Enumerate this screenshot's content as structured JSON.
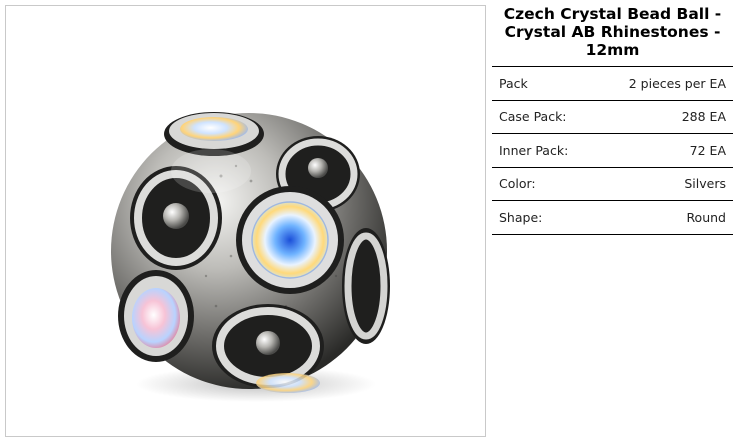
{
  "product": {
    "title": "Czech Crystal Bead Ball - Crystal AB Rhinestones - 12mm",
    "image_alt": "Czech crystal bead ball with crystal AB rhinestones"
  },
  "specs": [
    {
      "label": "Pack",
      "value": "2 pieces per EA"
    },
    {
      "label": "Case Pack:",
      "value": "288 EA"
    },
    {
      "label": "Inner Pack:",
      "value": "72 EA"
    },
    {
      "label": "Color:",
      "value": "Silvers"
    },
    {
      "label": "Shape:",
      "value": "Round"
    }
  ]
}
